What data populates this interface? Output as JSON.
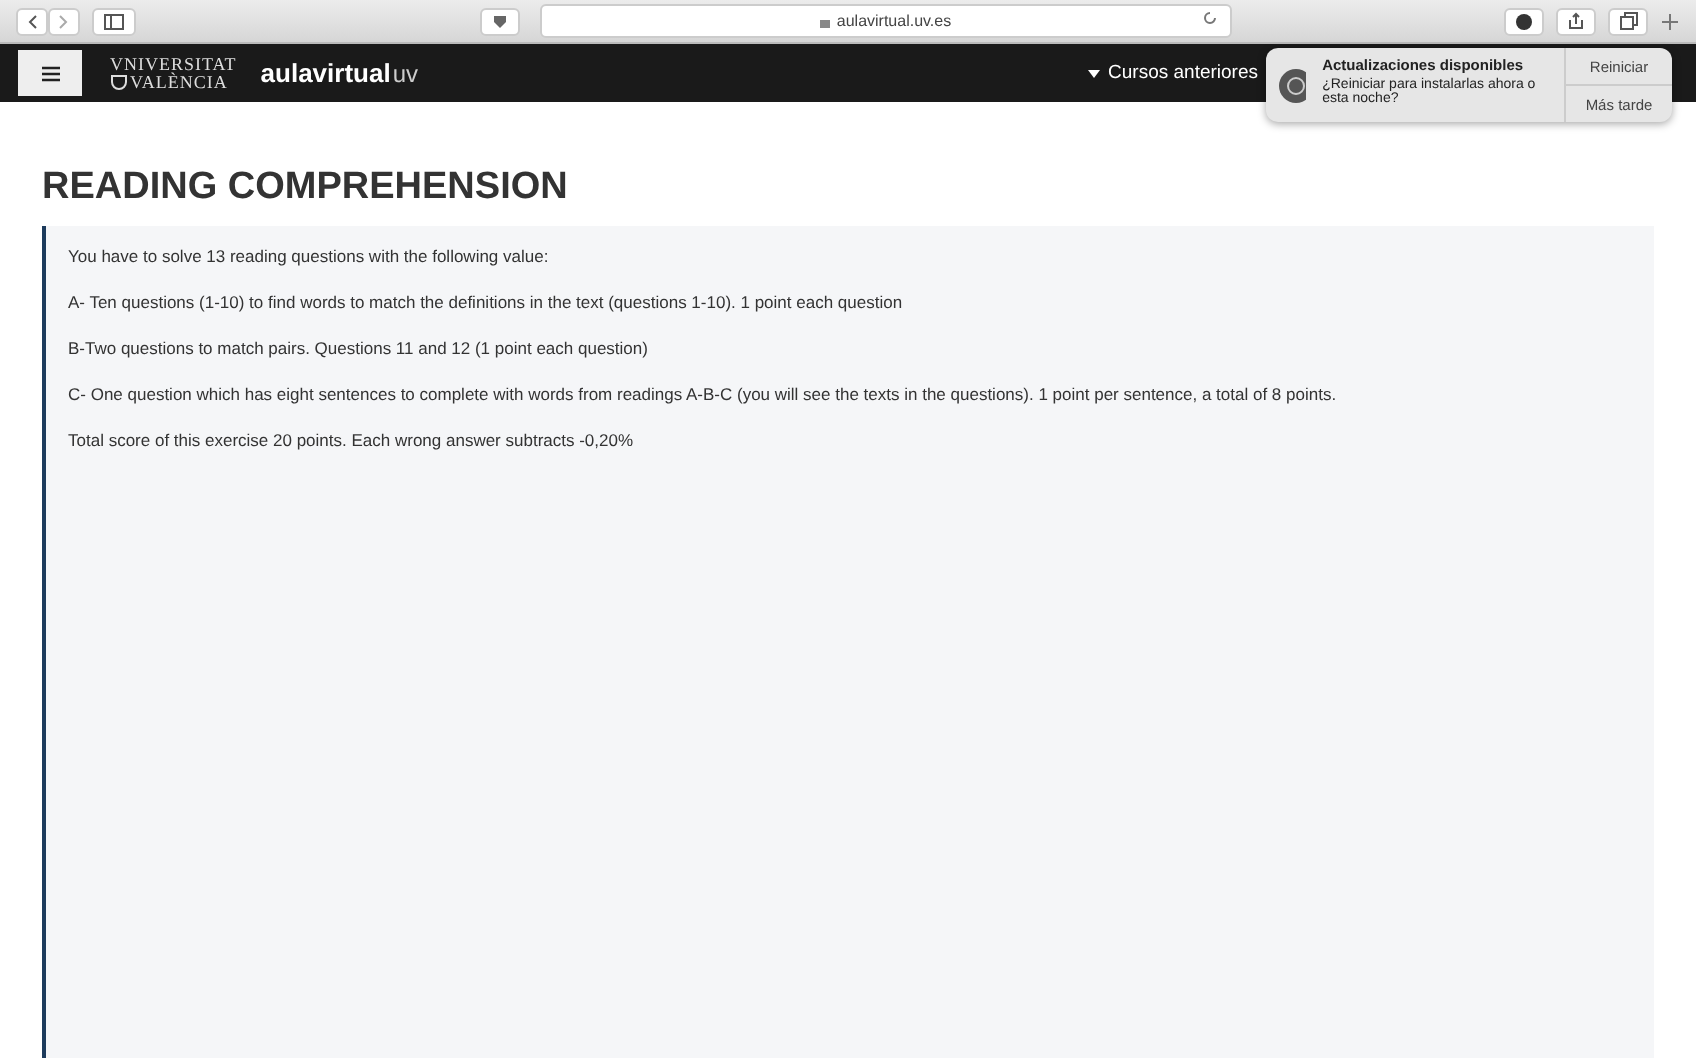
{
  "browser": {
    "url": "aulavirtual.uv.es"
  },
  "navbar": {
    "logo_line_1": "VNIVERSITAT",
    "logo_line_2": "VALÈNCIA",
    "brand": "aulavirtual",
    "brand_suffix": "uv",
    "menu": "Cursos anteriores"
  },
  "notification": {
    "title": "Actualizaciones disponibles",
    "message": "¿Reiniciar para instalarlas ahora o esta noche?",
    "buttons": [
      "Reiniciar",
      "Más tarde"
    ]
  },
  "page": {
    "heading": "READING COMPREHENSION",
    "paragraphs": [
      "You have to solve 13 reading questions with the following value:",
      "A- Ten questions (1-10) to find words to match the definitions in the text (questions 1-10). 1 point each question",
      "B-Two questions to match pairs. Questions 11 and 12 (1 point each question)",
      "C- One question which has eight sentences to complete with words from readings A-B-C (you will see the texts in the questions). 1 point per sentence, a total of 8 points.",
      "Total score of this exercise 20 points. Each wrong answer subtracts -0,20%"
    ]
  }
}
